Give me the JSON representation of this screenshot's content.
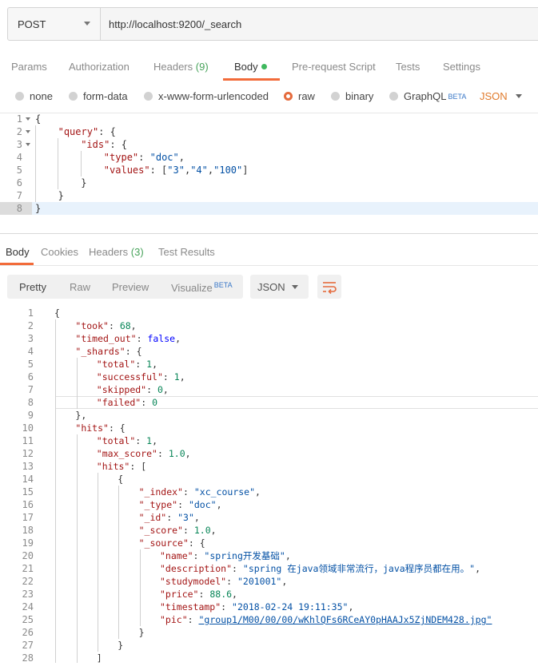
{
  "request": {
    "method": "POST",
    "url": "http://localhost:9200/_search"
  },
  "request_tabs": [
    {
      "label": "Params"
    },
    {
      "label": "Authorization"
    },
    {
      "label": "Headers",
      "count": "(9)"
    },
    {
      "label": "Body"
    },
    {
      "label": "Pre-request Script"
    },
    {
      "label": "Tests"
    },
    {
      "label": "Settings"
    }
  ],
  "body_types": {
    "none": "none",
    "form_data": "form-data",
    "urlencoded": "x-www-form-urlencoded",
    "raw": "raw",
    "binary": "binary",
    "graphql": "GraphQL",
    "beta": "BETA",
    "format": "JSON"
  },
  "request_body": {
    "line_numbers": [
      "1",
      "2",
      "3",
      "4",
      "5",
      "6",
      "7",
      "8"
    ],
    "lines": [
      "{",
      "    \"query\": {",
      "        \"ids\": {",
      "            \"type\": \"doc\",",
      "            \"values\": [\"3\",\"4\",\"100\"]",
      "        }",
      "    }",
      "}"
    ]
  },
  "response_tabs": [
    {
      "label": "Body"
    },
    {
      "label": "Cookies"
    },
    {
      "label": "Headers",
      "count": "(3)"
    },
    {
      "label": "Test Results"
    }
  ],
  "view_modes": {
    "pretty": "Pretty",
    "raw": "Raw",
    "preview": "Preview",
    "visualize": "Visualize",
    "beta": "BETA",
    "format": "JSON"
  },
  "response_body": {
    "line_numbers": [
      "1",
      "2",
      "3",
      "4",
      "5",
      "6",
      "7",
      "8",
      "9",
      "10",
      "11",
      "12",
      "13",
      "14",
      "15",
      "16",
      "17",
      "18",
      "19",
      "20",
      "21",
      "22",
      "23",
      "24",
      "25",
      "26",
      "27",
      "28"
    ],
    "lines": [
      "{",
      "    \"took\": 68,",
      "    \"timed_out\": false,",
      "    \"_shards\": {",
      "        \"total\": 1,",
      "        \"successful\": 1,",
      "        \"skipped\": 0,",
      "        \"failed\": 0",
      "    },",
      "    \"hits\": {",
      "        \"total\": 1,",
      "        \"max_score\": 1.0,",
      "        \"hits\": [",
      "            {",
      "                \"_index\": \"xc_course\",",
      "                \"_type\": \"doc\",",
      "                \"_id\": \"3\",",
      "                \"_score\": 1.0,",
      "                \"_source\": {",
      "                    \"name\": \"spring开发基础\",",
      "                    \"description\": \"spring 在java领域非常流行，java程序员都在用。\",",
      "                    \"studymodel\": \"201001\",",
      "                    \"price\": 88.6,",
      "                    \"timestamp\": \"2018-02-24 19:11:35\",",
      "                    \"pic\": \"group1/M00/00/00/wKhlQFs6RCeAY0pHAAJx5ZjNDEM428.jpg\"",
      "                }",
      "            }",
      "        ]"
    ]
  },
  "colors": {
    "accent": "#f26b3a",
    "key": "#a31515",
    "string": "#0451a5",
    "number": "#098658",
    "boolean": "#0000ff",
    "status_green": "#3fb85e"
  }
}
